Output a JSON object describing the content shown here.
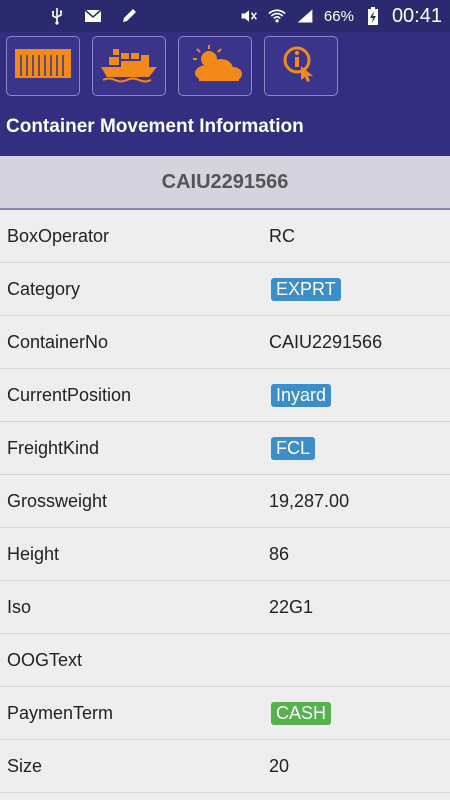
{
  "status_bar": {
    "battery": "66%",
    "clock": "00:41"
  },
  "toolbar": {
    "buttons": [
      {
        "icon": "container-icon"
      },
      {
        "icon": "ship-icon"
      },
      {
        "icon": "weather-icon"
      },
      {
        "icon": "info-touch-icon"
      }
    ],
    "accent_color": "#f28a1a"
  },
  "app_title": "Container Movement Information",
  "container_id": "CAIU2291566",
  "fields": [
    {
      "label": "BoxOperator",
      "value": "RC",
      "badge": ""
    },
    {
      "label": "Category",
      "value": "EXPRT",
      "badge": "blue"
    },
    {
      "label": "ContainerNo",
      "value": "CAIU2291566",
      "badge": ""
    },
    {
      "label": "CurrentPosition",
      "value": "Inyard",
      "badge": "blue"
    },
    {
      "label": "FreightKind",
      "value": "FCL",
      "badge": "blue"
    },
    {
      "label": "Grossweight",
      "value": "19,287.00",
      "badge": ""
    },
    {
      "label": "Height",
      "value": "86",
      "badge": ""
    },
    {
      "label": "Iso",
      "value": "22G1",
      "badge": ""
    },
    {
      "label": "OOGText",
      "value": "",
      "badge": ""
    },
    {
      "label": "PaymenTerm",
      "value": "CASH",
      "badge": "green"
    },
    {
      "label": "Size",
      "value": "20",
      "badge": ""
    }
  ]
}
